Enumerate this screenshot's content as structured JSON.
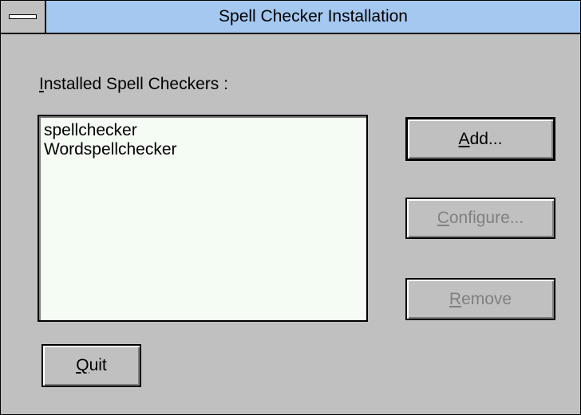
{
  "window": {
    "title": "Spell Checker Installation"
  },
  "label": {
    "mnemonic": "I",
    "rest": "nstalled Spell Checkers :"
  },
  "list": {
    "items": [
      "spellchecker",
      "Wordspellchecker"
    ]
  },
  "buttons": {
    "add": {
      "mnemonic": "A",
      "rest": "dd...",
      "enabled": true
    },
    "configure": {
      "mnemonic": "C",
      "rest": "onfigure...",
      "enabled": false
    },
    "remove": {
      "mnemonic": "R",
      "rest": "emove",
      "enabled": false
    },
    "quit": {
      "mnemonic": "Q",
      "rest": "uit",
      "enabled": true
    }
  },
  "icons": {
    "system_menu": "system-menu-icon"
  },
  "colors": {
    "titlebar": "#a5c8f0",
    "window_bg": "#c0c0c0",
    "listbox_bg": "#f4fcf4",
    "disabled_text": "#808080"
  }
}
